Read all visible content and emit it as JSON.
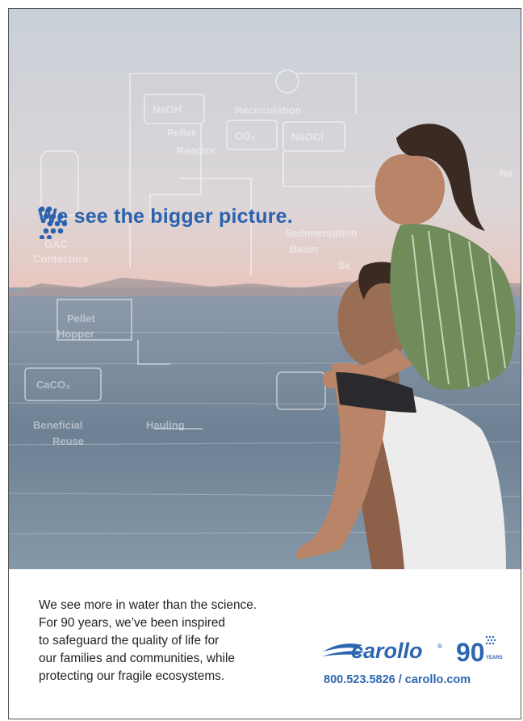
{
  "headline": "We see the bigger picture.",
  "diagram_labels": [
    "NaOH",
    "Recirculation",
    "Pellet",
    "Reactor",
    "CO₂",
    "NaOCl",
    "Sedimentation",
    "Basin",
    "GAC",
    "Contactors",
    "Pellet",
    "Hopper",
    "CaCO₃",
    "Beneficial",
    "Reuse",
    "Hauling",
    "Se",
    "Na"
  ],
  "body_copy": [
    "We see more in water than the science.",
    "For 90 years, we’ve been inspired",
    "to safeguard the quality of life for",
    "our families and communities, while",
    "protecting our fragile ecosystems."
  ],
  "brand": {
    "logo_text": "carollo",
    "registered": "®",
    "anniversary_number": "90",
    "anniversary_word": "YEARS"
  },
  "contact": "800.523.5826 / carollo.com",
  "colors": {
    "brand_blue": "#2d66b0",
    "text": "#222222"
  }
}
